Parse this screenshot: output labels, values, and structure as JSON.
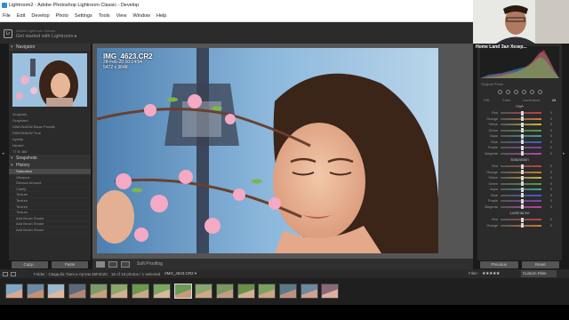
{
  "window": {
    "title": "Lightroom2 - Adobe Photoshop Lightroom Classic - Develop"
  },
  "menu": [
    "File",
    "Edit",
    "Develop",
    "Photo",
    "Settings",
    "Tools",
    "View",
    "Window",
    "Help"
  ],
  "identity": {
    "small_text": "Adobe Lightroom Classic",
    "big_text": "Get started with Lightroom ▸"
  },
  "left_panel": {
    "navigator_label": "Navigator",
    "presets": [
      "Grayhirle",
      "Grayhired",
      "DIMONADW-Blanc Proxiile",
      "DIMONADW-True",
      "Ayenty",
      "Newert",
      "TT B 460"
    ],
    "snapshots_label": "Snapshots",
    "history_label": "History",
    "history": [
      "Saturation",
      "Vibrance",
      "Dehaze Amount",
      "Clarity",
      "Texture",
      "Texture",
      "Texture",
      "Texture",
      "Add Brush Stroke",
      "Add Brush Stroke",
      "Add Brush Stroke"
    ],
    "copy_label": "Copy...",
    "paste_label": "Paste"
  },
  "photo_info": {
    "filename": "IMG_4623.CR2",
    "date": "28-Feb-20 10:14:54",
    "dimensions": "5472 x 3648"
  },
  "toolbar": {
    "soft_proofing": "Soft Proofing"
  },
  "right_panel": {
    "original_photo": "Original Photo",
    "tabs": [
      "HSL",
      "Color",
      "Luminance",
      "All"
    ],
    "hue_label": "Hue",
    "saturation_label": "Saturation",
    "luminance_label": "Luminance",
    "colors": [
      "Red",
      "Orange",
      "Yellow",
      "Green",
      "Aqua",
      "Blue",
      "Purple",
      "Magenta"
    ],
    "hue_values": [
      0,
      0,
      0,
      0,
      0,
      0,
      0,
      0
    ],
    "saturation_values": [
      0,
      0,
      0,
      0,
      0,
      0,
      0,
      0
    ],
    "luminance_values": [
      0,
      0
    ],
    "previous_label": "Previous",
    "reset_label": "Reset"
  },
  "filmbar": {
    "folder": "Folder : Свадьба Таня и Артем 28Feb20",
    "count": "18 of 18 photos / 1 selected",
    "file": "/IMG_4623.CR2 ▾",
    "filter_label": "Filter :",
    "stars": "★★★★★",
    "custom_filter": "Custom Filter"
  },
  "filmstrip": {
    "thumb_count": 16,
    "selected_index": 8
  },
  "webcam": {
    "name": "Home Land Зал Хезер..."
  },
  "colors": {
    "panel_bg": "#2b2b2b",
    "center_bg": "#555555",
    "accent": "#2b8fd6"
  }
}
